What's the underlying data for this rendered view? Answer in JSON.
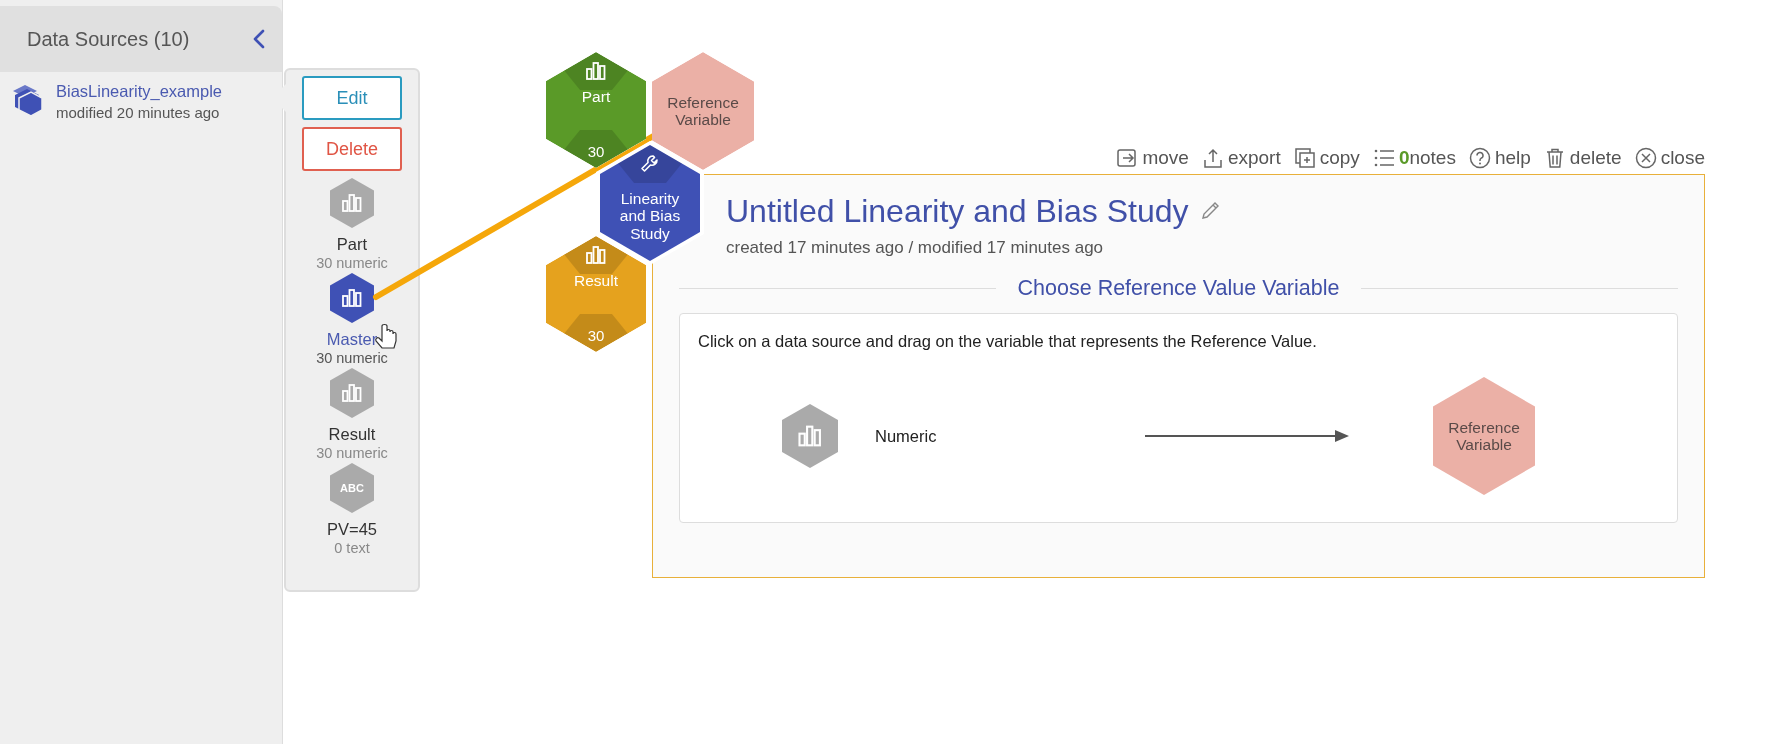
{
  "sidebar": {
    "title": "Data Sources (10)",
    "datasets": [
      {
        "name": "BiasLinearity_example",
        "modified": "modified 20 minutes ago"
      }
    ]
  },
  "popover": {
    "buttons": [
      {
        "label": "Edit",
        "kind": "edit"
      },
      {
        "label": "Delete",
        "kind": "delete"
      }
    ],
    "variables": [
      {
        "name": "Part",
        "info": "30 numeric",
        "kind": "numeric",
        "selected": false
      },
      {
        "name": "Master",
        "info": "30 numeric",
        "kind": "numeric",
        "selected": true
      },
      {
        "name": "Result",
        "info": "30 numeric",
        "kind": "numeric",
        "selected": false
      },
      {
        "name": "PV=45",
        "info": "0 text",
        "kind": "text",
        "badge": "ABC",
        "selected": false
      }
    ]
  },
  "canvas": {
    "nodes": [
      {
        "kind": "variable",
        "label": "Part",
        "count": "30",
        "color": "#5a9a28"
      },
      {
        "kind": "slot",
        "label": "Reference Variable",
        "color": "#ebb0a6"
      },
      {
        "kind": "study",
        "label": "Linearity and Bias Study",
        "color": "#3f51b5"
      },
      {
        "kind": "variable",
        "label": "Result",
        "count": "30",
        "color": "#e5a21e"
      }
    ]
  },
  "toolbar": [
    {
      "kind": "move",
      "label": "move"
    },
    {
      "kind": "export",
      "label": "export"
    },
    {
      "kind": "copy",
      "label": "copy"
    },
    {
      "kind": "notes",
      "label": "notes",
      "count": "0"
    },
    {
      "kind": "help",
      "label": "help"
    },
    {
      "kind": "delete",
      "label": "delete"
    },
    {
      "kind": "close",
      "label": "close"
    }
  ],
  "card": {
    "title": "Untitled Linearity and Bias Study",
    "meta": "created 17 minutes ago / modified 17 minutes ago",
    "section": "Choose Reference Value Variable",
    "instruction": "Click on a data source and drag on the variable that represents the Reference Value.",
    "source_label": "Numeric",
    "target_label": "Reference Variable"
  }
}
